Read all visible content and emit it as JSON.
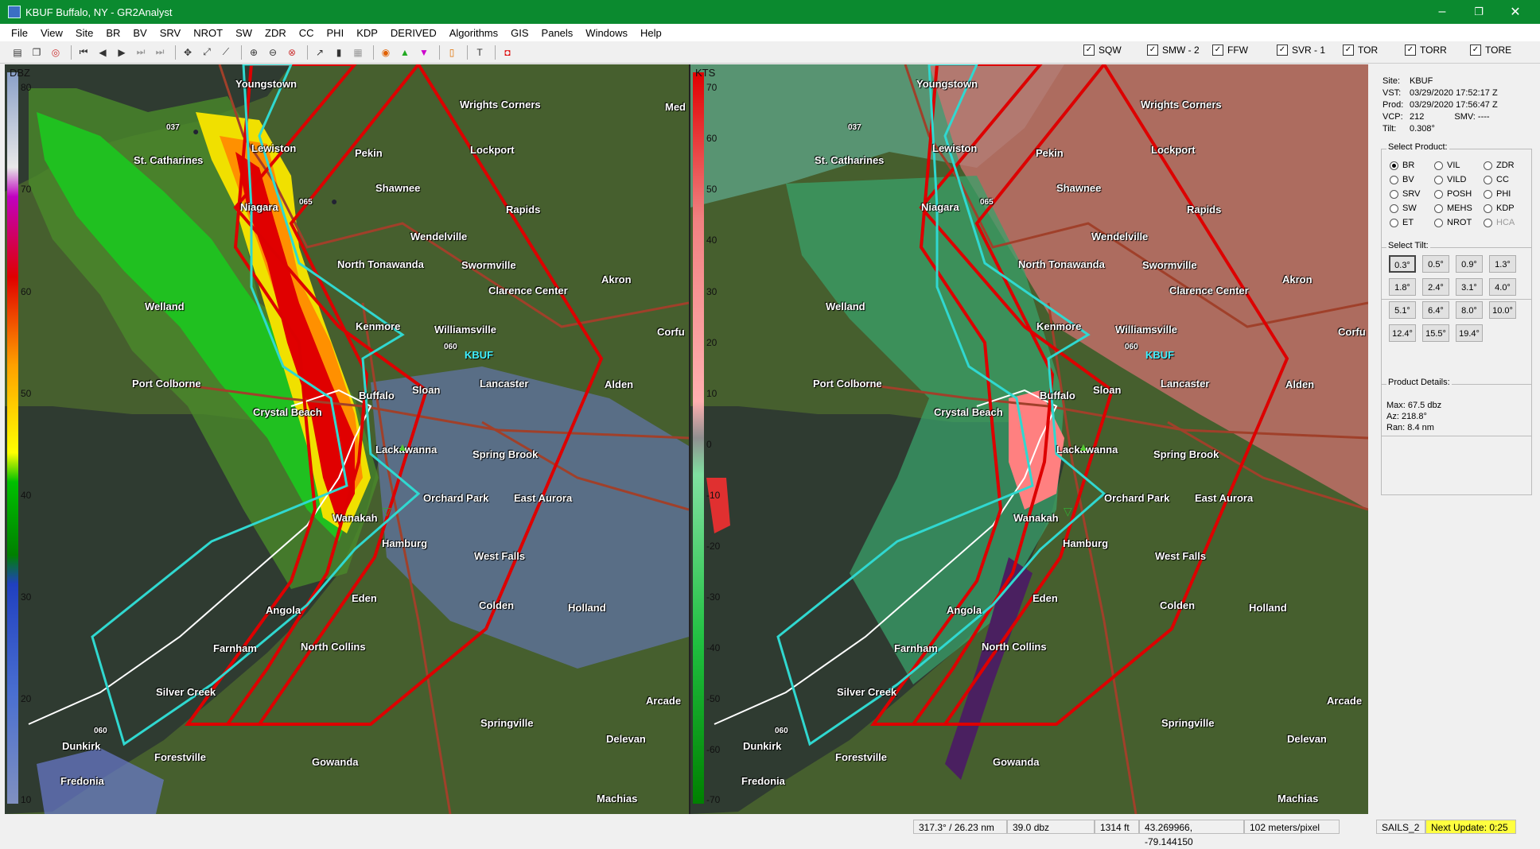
{
  "window": {
    "title": "KBUF Buffalo, NY - GR2Analyst",
    "minimize": "–",
    "maximize": "❐",
    "close": "✕"
  },
  "menu": [
    "File",
    "View",
    "Site",
    "BR",
    "BV",
    "SRV",
    "NROT",
    "SW",
    "ZDR",
    "CC",
    "PHI",
    "KDP",
    "DERIVED",
    "Algorithms",
    "GIS",
    "Panels",
    "Windows",
    "Help"
  ],
  "warnings": [
    {
      "label": "SQW",
      "checked": true
    },
    {
      "label": "SMW - 2",
      "checked": true
    },
    {
      "label": "FFW",
      "checked": true
    },
    {
      "label": "SVR - 1",
      "checked": true
    },
    {
      "label": "TOR",
      "checked": true
    },
    {
      "label": "TORR",
      "checked": true
    },
    {
      "label": "TORE",
      "checked": true
    }
  ],
  "left_pane": {
    "unit": "DBZ",
    "scale": [
      "80",
      "70",
      "60",
      "50",
      "40",
      "30",
      "20",
      "10"
    ],
    "colors": {
      "stops": [
        "#8aa0c8",
        "#e8e8e8",
        "#c000c0",
        "#e00000",
        "#ffa000",
        "#ffff00",
        "#00c000",
        "#008000",
        "#2040c0",
        "#4a6fd0",
        "#8090c0"
      ]
    }
  },
  "right_pane": {
    "unit": "KTS",
    "scale": [
      "70",
      "60",
      "50",
      "40",
      "30",
      "20",
      "10",
      "0",
      "-10",
      "-20",
      "-30",
      "-40",
      "-50",
      "-60",
      "-70"
    ],
    "colors": {
      "stops": [
        "#e00000",
        "#f08080",
        "#ffb0b0",
        "#909090",
        "#80e0a0",
        "#20c040",
        "#008000"
      ]
    }
  },
  "cities": [
    "Youngstown",
    "Wrights Corners",
    "Lewiston",
    "Pekin",
    "Lockport",
    "St. Catharines",
    "Shawnee",
    "Rapids",
    "Niagara",
    "Wendelville",
    "North Tonawanda",
    "Swormville",
    "Akron",
    "Clarence Center",
    "Welland",
    "Kenmore",
    "Williamsville",
    "Corfu",
    "Port Colborne",
    "Lancaster",
    "Alden",
    "Buffalo",
    "Sloan",
    "Crystal Beach",
    "Lackawanna",
    "Spring Brook",
    "Orchard Park",
    "East Aurora",
    "Wanakah",
    "Hamburg",
    "West Falls",
    "Eden",
    "Colden",
    "Holland",
    "Angola",
    "North Collins",
    "Farnham",
    "Silver Creek",
    "Arcade",
    "Springville",
    "Delevan",
    "Dunkirk",
    "Forestville",
    "Gowanda",
    "Fredonia",
    "Machias",
    "Med"
  ],
  "site_label": "KBUF",
  "markers": [
    "037",
    "065",
    "060",
    "060"
  ],
  "info": {
    "site": "KBUF",
    "vst": "03/29/2020  17:52:17 Z",
    "prod": "03/29/2020  17:56:47 Z",
    "vcp": "212",
    "smv": "SMV: ----",
    "tilt": "0.308°"
  },
  "select_product": {
    "title": "Select Product:",
    "items": [
      "BR",
      "VIL",
      "ZDR",
      "BV",
      "VILD",
      "CC",
      "SRV",
      "POSH",
      "PHI",
      "SW",
      "MEHS",
      "KDP",
      "ET",
      "NROT",
      "HCA"
    ],
    "selected": "BR"
  },
  "select_tilt": {
    "title": "Select Tilt:",
    "items": [
      "0.3°",
      "0.5°",
      "0.9°",
      "1.3°",
      "1.8°",
      "2.4°",
      "3.1°",
      "4.0°",
      "5.1°",
      "6.4°",
      "8.0°",
      "10.0°",
      "12.4°",
      "15.5°",
      "19.4°"
    ],
    "selected": "0.3°"
  },
  "details": {
    "title": "Product Details:",
    "max": "Max:  67.5 dbz",
    "az": "Az:  218.8°",
    "ran": "Ran:  8.4 nm"
  },
  "status": {
    "azran": "317.3° / 26.23 nm",
    "value": "39.0 dbz",
    "height": "1314 ft",
    "coords": "43.269966, -79.144150",
    "res": "102 meters/pixel",
    "mode": "SAILS_2",
    "next": "Next Update: 0:25"
  }
}
